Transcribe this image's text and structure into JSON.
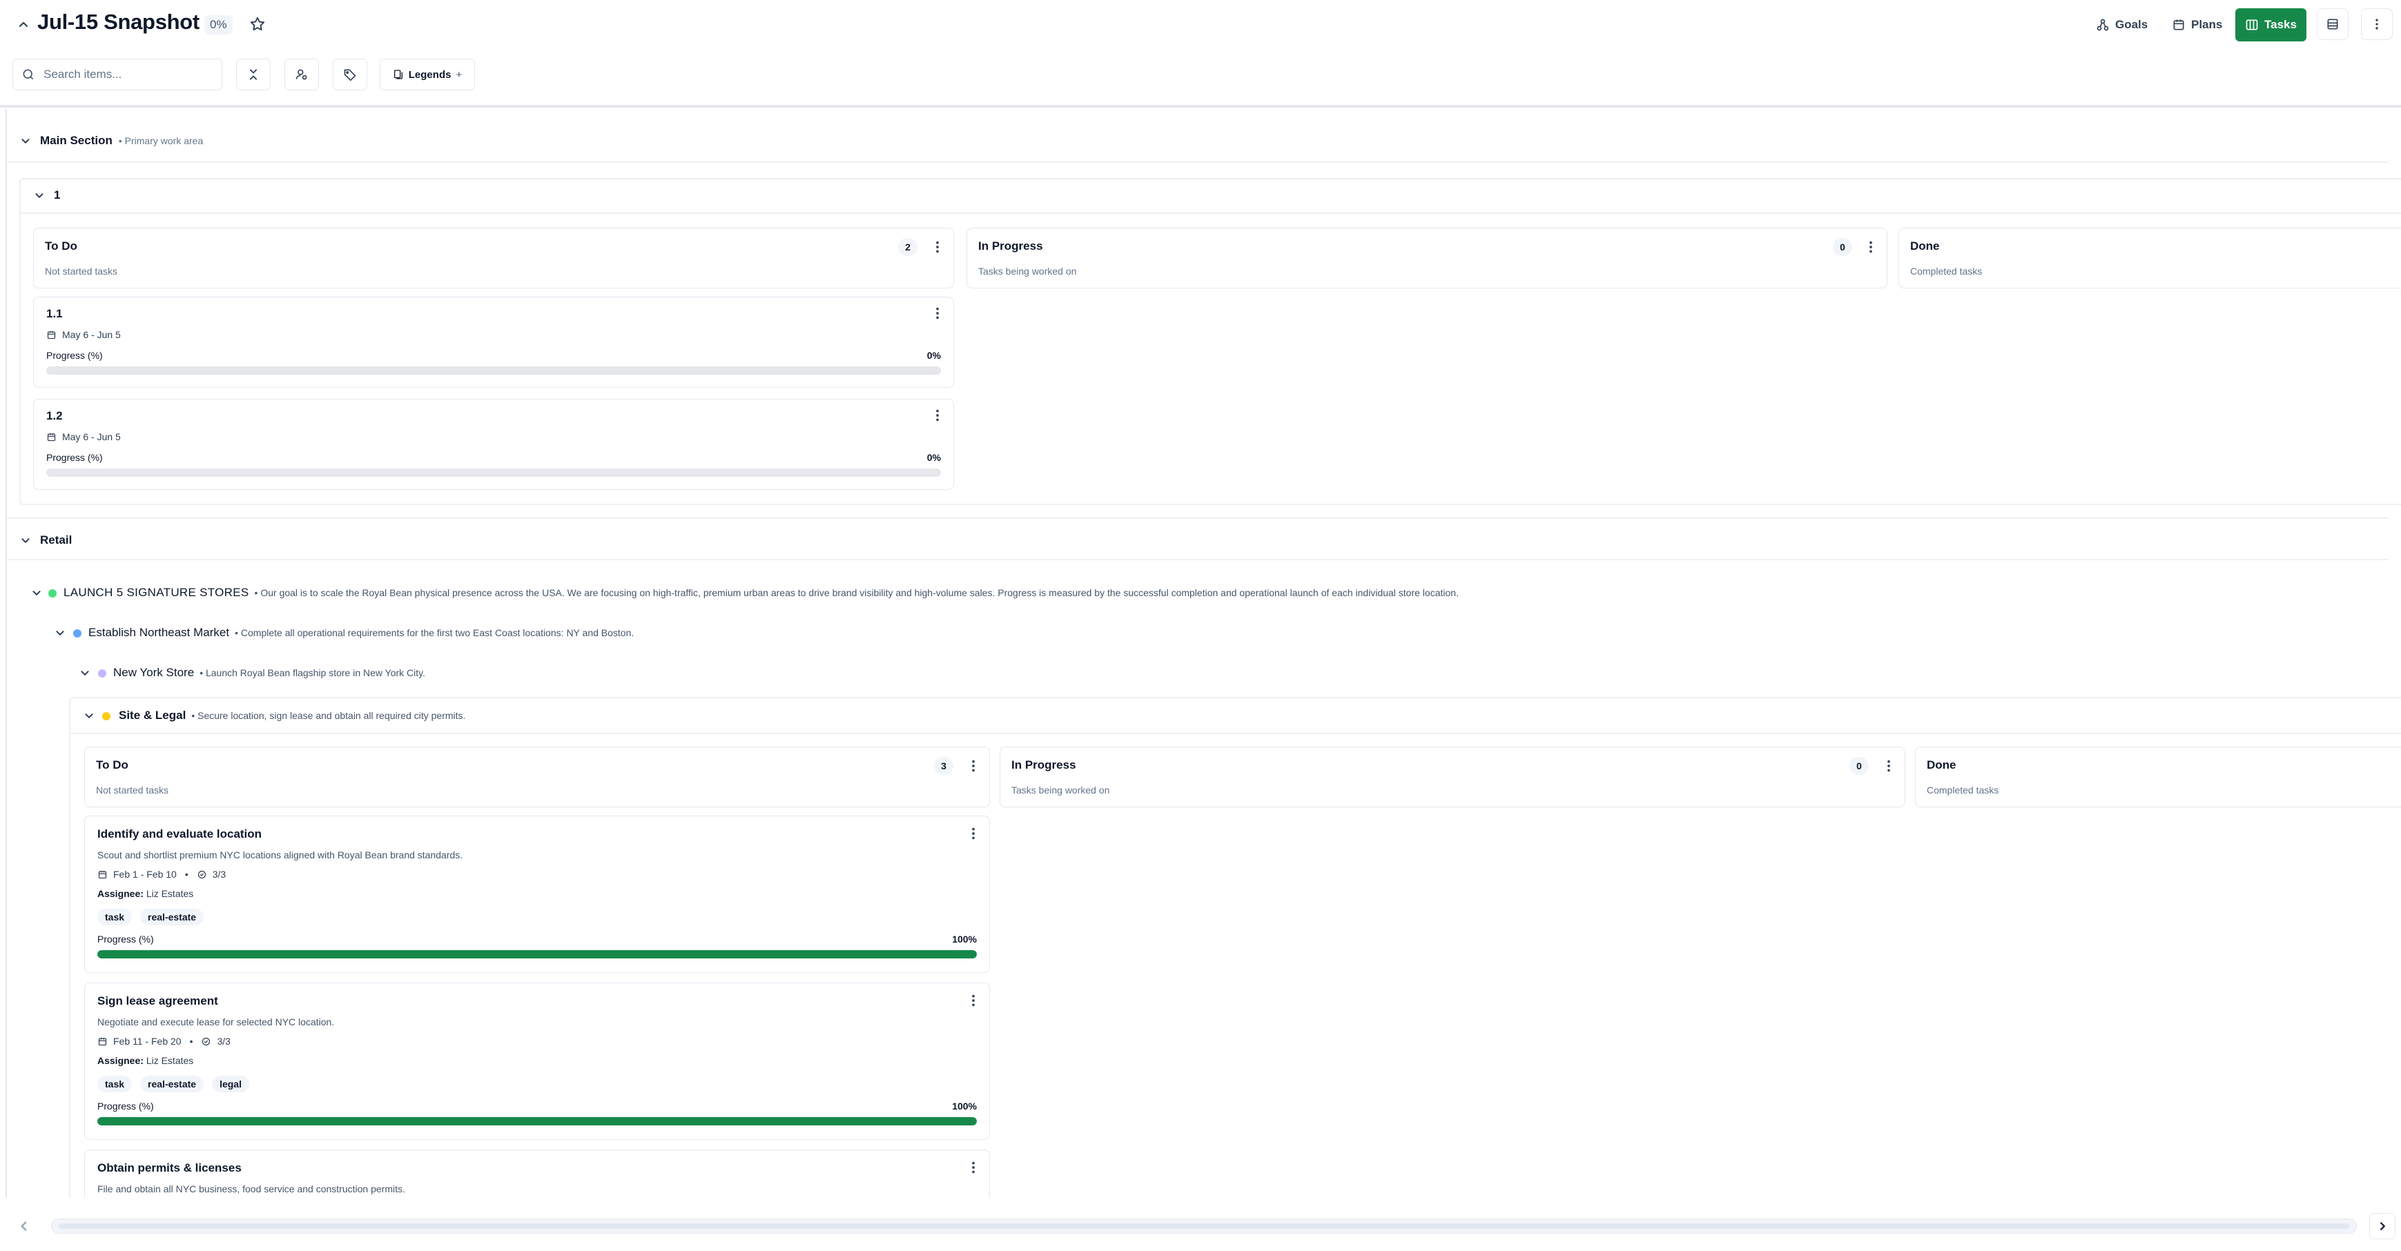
{
  "header": {
    "title": "Jul-15 Snapshot",
    "progress_badge": "0%",
    "nav": [
      {
        "label": "Goals",
        "icon": "goals-icon"
      },
      {
        "label": "Plans",
        "icon": "calendar-icon"
      },
      {
        "label": "Tasks",
        "icon": "board-icon",
        "active": true
      }
    ]
  },
  "toolbar": {
    "search_placeholder": "Search items...",
    "legends_label": "Legends",
    "legends_plus": "+"
  },
  "colors": {
    "accent": "#16894a",
    "dot_goal": "#4ade80",
    "dot_objective": "#60a5fa",
    "dot_project": "#c4b5fd",
    "dot_phase": "#facc15"
  },
  "main_section": {
    "title": "Main Section",
    "subtitle": "• Primary work area",
    "group": {
      "title": "1",
      "columns": [
        {
          "title": "To Do",
          "desc": "Not started tasks",
          "count": "2"
        },
        {
          "title": "In Progress",
          "desc": "Tasks being worked on",
          "count": "0"
        },
        {
          "title": "Done",
          "desc": "Completed tasks"
        }
      ],
      "cards": [
        {
          "title": "1.1",
          "dates": "May 6 - Jun 5",
          "progress_label": "Progress (%)",
          "progress_text": "0%",
          "progress": 0
        },
        {
          "title": "1.2",
          "dates": "May 6 - Jun 5",
          "progress_label": "Progress (%)",
          "progress_text": "0%",
          "progress": 0
        }
      ]
    }
  },
  "retail": {
    "title": "Retail",
    "goal": {
      "title": "LAUNCH 5 SIGNATURE STORES",
      "desc": "• Our goal is to scale the Royal Bean physical presence across the USA. We are focusing on high-traffic, premium urban areas to drive brand visibility and high-volume sales. Progress is measured by the successful completion and operational launch of each individual store location."
    },
    "objective": {
      "title": "Establish Northeast Market",
      "desc": "• Complete all operational requirements for the first two East Coast locations: NY and Boston."
    },
    "project": {
      "title": "New York Store",
      "desc": "• Launch Royal Bean flagship store in New York City."
    },
    "phase": {
      "title": "Site & Legal",
      "desc": "• Secure location, sign lease and obtain all required city permits."
    },
    "columns": [
      {
        "title": "To Do",
        "desc": "Not started tasks",
        "count": "3"
      },
      {
        "title": "In Progress",
        "desc": "Tasks being worked on",
        "count": "0"
      },
      {
        "title": "Done",
        "desc": "Completed tasks"
      }
    ],
    "cards": [
      {
        "title": "Identify and evaluate location",
        "desc": "Scout and shortlist premium NYC locations aligned with Royal Bean brand standards.",
        "dates": "Feb 1 - Feb 10",
        "separator": "•",
        "checks": "3/3",
        "assignee_label": "Assignee:",
        "assignee": "Liz Estates",
        "tags": [
          "task",
          "real-estate"
        ],
        "progress_label": "Progress (%)",
        "progress_text": "100%",
        "progress": 1.0
      },
      {
        "title": "Sign lease agreement",
        "desc": "Negotiate and execute lease for selected NYC location.",
        "dates": "Feb 11 - Feb 20",
        "separator": "•",
        "checks": "3/3",
        "assignee_label": "Assignee:",
        "assignee": "Liz Estates",
        "tags": [
          "task",
          "real-estate",
          "legal"
        ],
        "progress_label": "Progress (%)",
        "progress_text": "100%",
        "progress": 1.0
      },
      {
        "title": "Obtain permits & licenses",
        "desc": "File and obtain all NYC business, food service and construction permits."
      }
    ]
  }
}
